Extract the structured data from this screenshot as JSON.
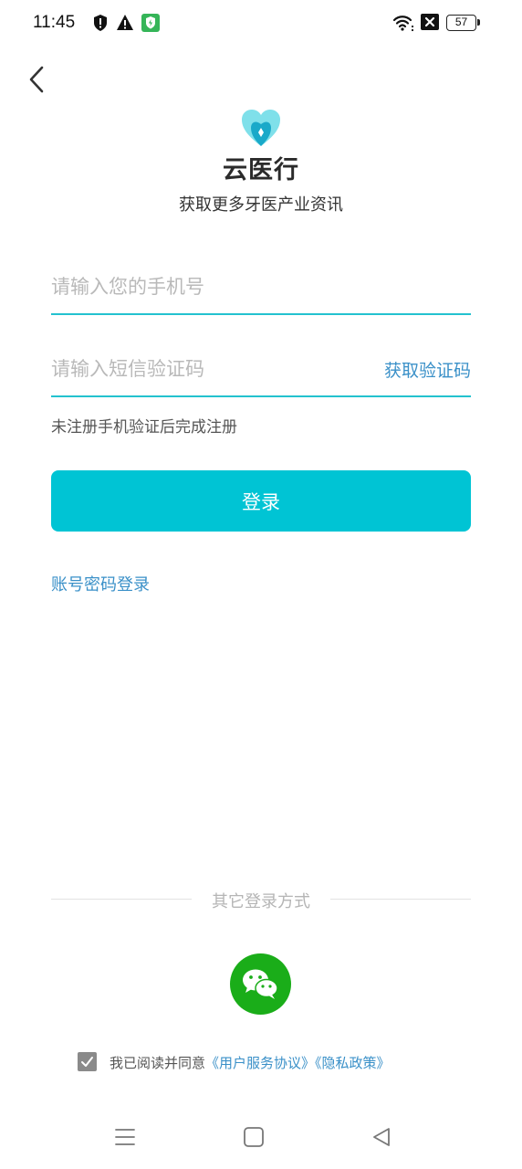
{
  "status_bar": {
    "time": "11:45",
    "battery": "57",
    "icons": [
      "shield-icon",
      "warning-icon",
      "vpn-shield-icon",
      "wifi-icon",
      "no-sim-icon",
      "battery-icon"
    ]
  },
  "header": {
    "back_icon": "chevron-left-icon"
  },
  "brand": {
    "name": "云医行",
    "tagline": "获取更多牙医产业资讯",
    "colors": {
      "logo_light": "#7fe0ea",
      "logo_dark": "#1aa9c9"
    }
  },
  "form": {
    "phone_placeholder": "请输入您的手机号",
    "phone_value": "",
    "code_placeholder": "请输入短信验证码",
    "code_value": "",
    "get_code_label": "获取验证码",
    "hint": "未注册手机验证后完成注册",
    "login_label": "登录",
    "password_login_label": "账号密码登录"
  },
  "other_login": {
    "title": "其它登录方式",
    "wechat_icon": "wechat-icon"
  },
  "agreement": {
    "checked": true,
    "prefix": "我已阅读并同意",
    "terms_link": "《用户服务协议》",
    "privacy_link": "《隐私政策》"
  },
  "nav_bar": {
    "icons": [
      "menu-icon",
      "home-square-icon",
      "back-triangle-icon"
    ]
  },
  "theme": {
    "accent": "#00c4d4",
    "link": "#3a90c8",
    "underline": "#23c2cf",
    "wechat_green": "#1aad19"
  }
}
